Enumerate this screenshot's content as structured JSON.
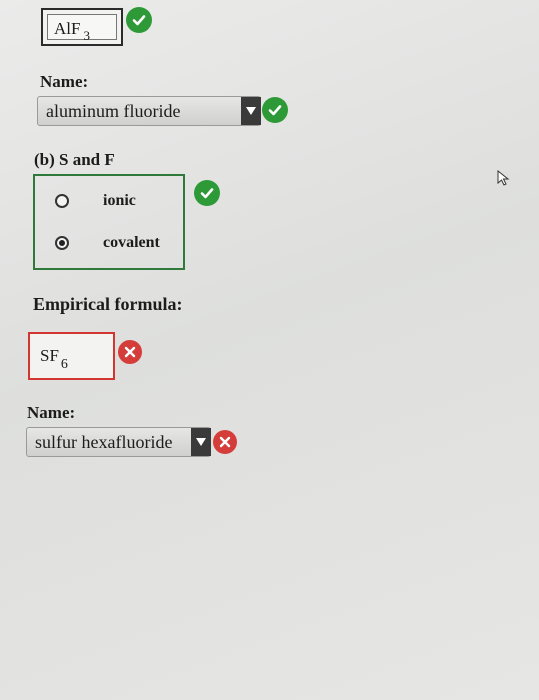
{
  "part_a": {
    "formula_main": "AlF",
    "formula_subscript": "3",
    "formula_status": "correct",
    "name_label": "Name:",
    "name_selected": "aluminum fluoride",
    "name_status": "correct"
  },
  "part_b": {
    "heading": "(b) S and F",
    "bond_options": [
      {
        "label": "ionic",
        "selected": false
      },
      {
        "label": "covalent",
        "selected": true
      }
    ],
    "bond_status": "correct",
    "empirical_label": "Empirical formula:",
    "formula_main": "SF",
    "formula_subscript": "6",
    "formula_status": "incorrect",
    "name_label": "Name:",
    "name_selected": "sulfur hexafluoride",
    "name_status": "incorrect"
  },
  "colors": {
    "correct": "#2e9a37",
    "incorrect": "#d43d3a",
    "group_border": "#2f7a3a"
  },
  "icons": {
    "correct": "check-icon",
    "incorrect": "x-icon",
    "dropdown": "triangle-down-icon"
  }
}
